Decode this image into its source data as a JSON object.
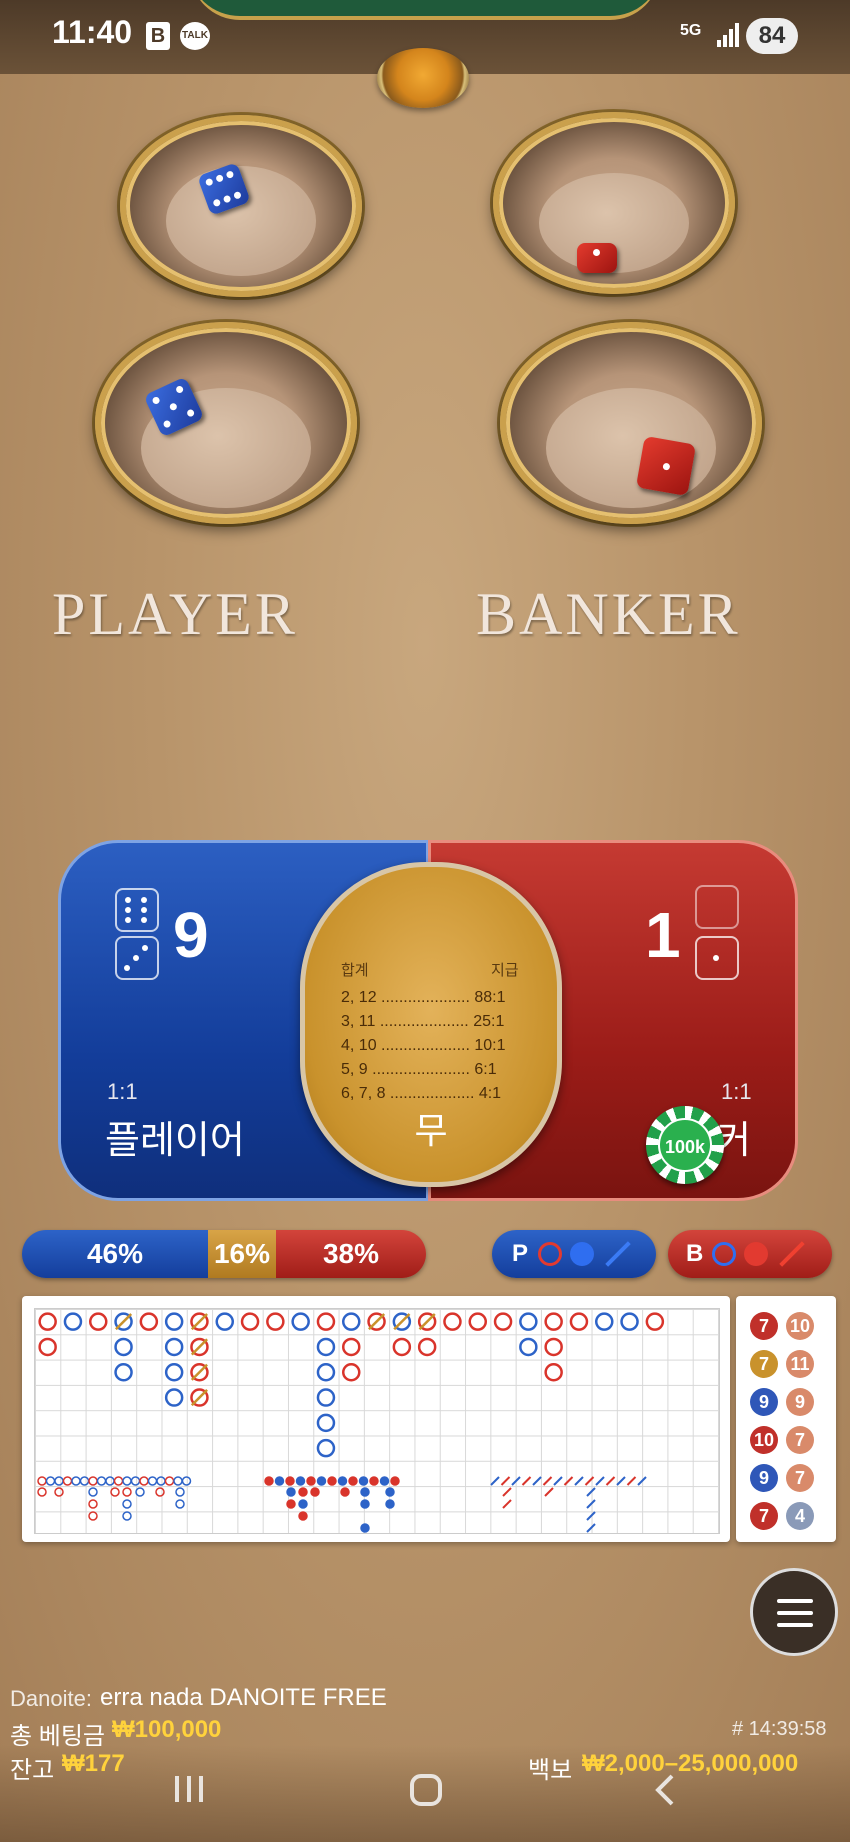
{
  "status_bar": {
    "time": "11:40",
    "network": "5G",
    "battery": "84",
    "app_b": "B",
    "app_talk": "TALK"
  },
  "table": {
    "player_title": "PLAYER",
    "banker_title": "BANKER"
  },
  "bets": {
    "player": {
      "score": "9",
      "odds": "1:1",
      "label": "플레이어"
    },
    "banker": {
      "score": "1",
      "odds": "1:1",
      "label": "뱅커"
    },
    "tie": {
      "head_left": "합계",
      "head_right": "지급",
      "rows": [
        "2, 12 .................... 88:1",
        "3, 11 .................... 25:1",
        "4, 10 .................... 10:1",
        "5, 9 ......................  6:1",
        "6, 7, 8 ...................  4:1"
      ],
      "label": "무"
    },
    "chip": "100k"
  },
  "stats": {
    "player_pct": "46%",
    "tie_pct": "16%",
    "banker_pct": "38%",
    "player_pred": "P",
    "banker_pred": "B"
  },
  "side_numbers": [
    [
      "7",
      "10"
    ],
    [
      "7",
      "11"
    ],
    [
      "9",
      "9"
    ],
    [
      "10",
      "7"
    ],
    [
      "9",
      "7"
    ],
    [
      "7",
      "4"
    ]
  ],
  "footer": {
    "user": "Danoite:",
    "message": "erra nada DANOITE FREE",
    "total_bet_label": "총 베팅금",
    "total_bet": "₩100,000",
    "game_id": "# 14:39:58",
    "balance_label": "잔고",
    "balance": "₩177",
    "limits_label": "백보",
    "limits": "₩2,000–25,000,000"
  },
  "colors": {
    "player": "#1d4fb8",
    "banker": "#c0302a",
    "tie": "#c9922c"
  }
}
